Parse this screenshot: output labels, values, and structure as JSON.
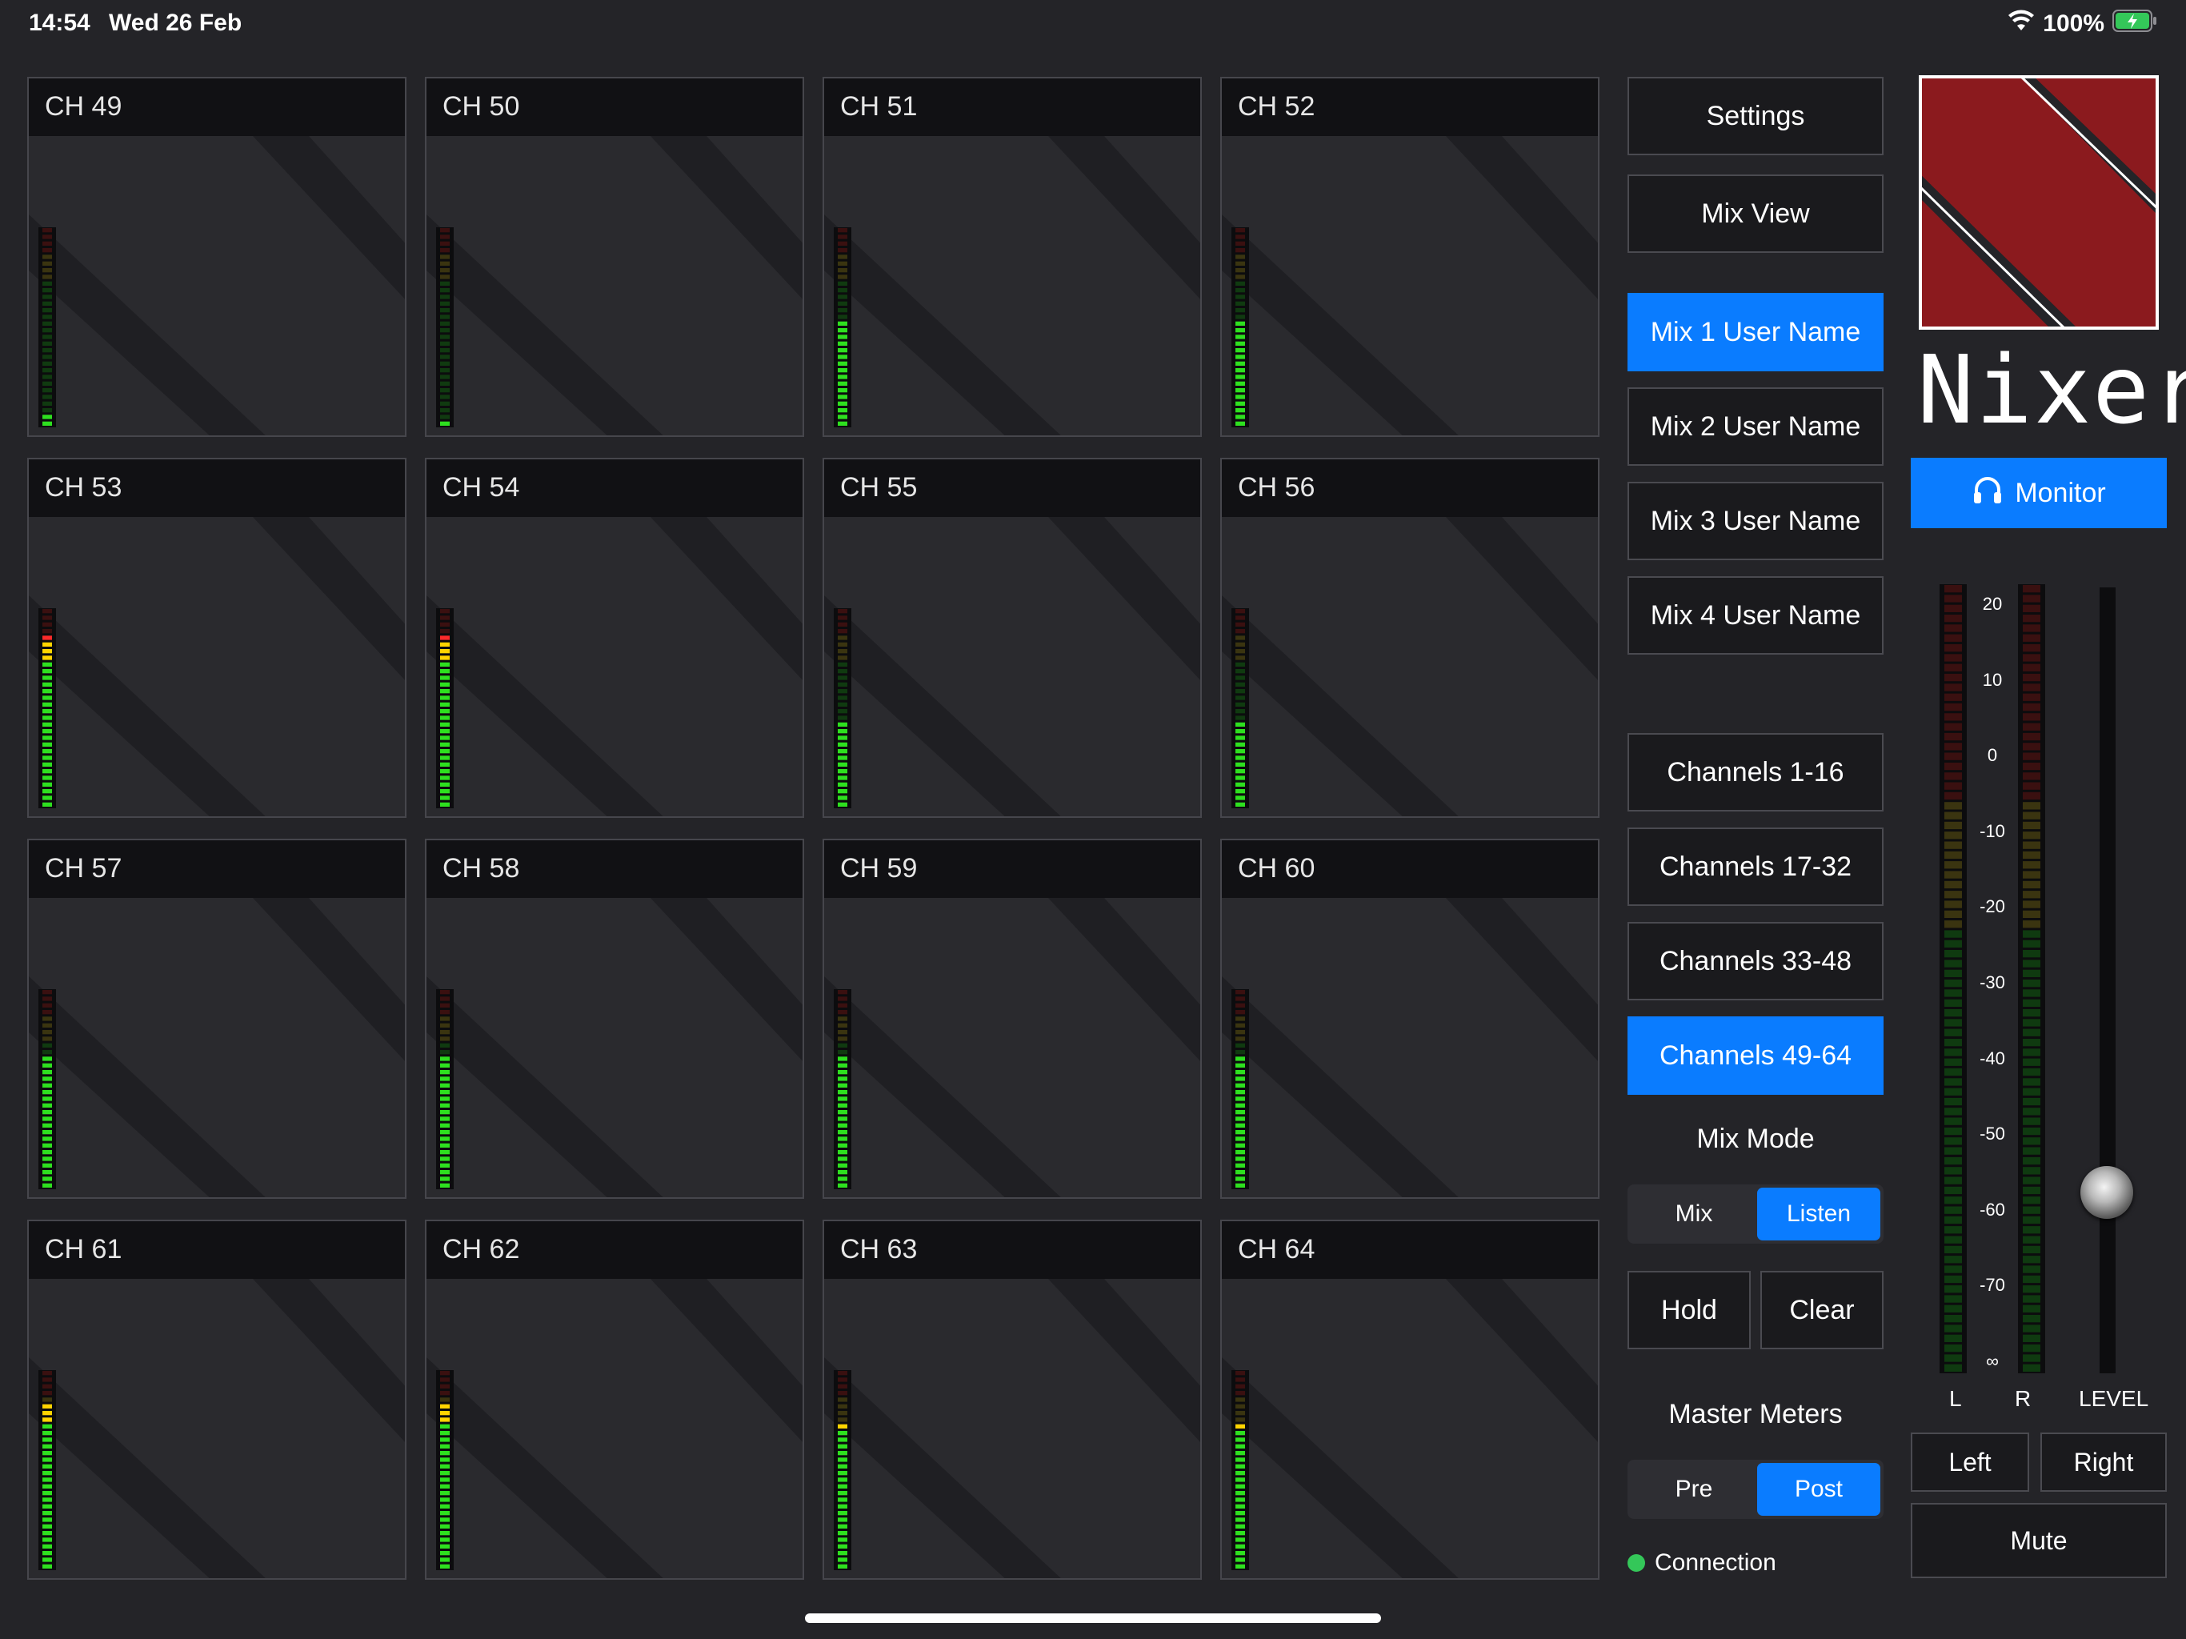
{
  "status_bar": {
    "time": "14:54",
    "date": "Wed 26 Feb",
    "battery": "100%",
    "wifi_icon": "wifi-icon",
    "battery_icon": "battery-charging-icon"
  },
  "channels": [
    {
      "name": "CH 49",
      "level": 0.07,
      "peak": null
    },
    {
      "name": "CH 50",
      "level": 0.03,
      "peak": null
    },
    {
      "name": "CH 51",
      "level": 0.53,
      "peak": null
    },
    {
      "name": "CH 52",
      "level": 0.53,
      "peak": null
    },
    {
      "name": "CH 53",
      "level": 0.87,
      "peak": "red"
    },
    {
      "name": "CH 54",
      "level": 0.87,
      "peak": "red"
    },
    {
      "name": "CH 55",
      "level": 0.43,
      "peak": null
    },
    {
      "name": "CH 56",
      "level": 0.43,
      "peak": null
    },
    {
      "name": "CH 57",
      "level": 0.67,
      "peak": null
    },
    {
      "name": "CH 58",
      "level": 0.67,
      "peak": null
    },
    {
      "name": "CH 59",
      "level": 0.67,
      "peak": null
    },
    {
      "name": "CH 60",
      "level": 0.67,
      "peak": null
    },
    {
      "name": "CH 61",
      "level": 0.83,
      "peak": null
    },
    {
      "name": "CH 62",
      "level": 0.83,
      "peak": null
    },
    {
      "name": "CH 63",
      "level": 0.73,
      "peak": "yellow"
    },
    {
      "name": "CH 64",
      "level": 0.73,
      "peak": "yellow"
    }
  ],
  "nav": {
    "settings": "Settings",
    "mix_view": "Mix View",
    "mixes": [
      {
        "label": "Mix 1 User Name",
        "active": true
      },
      {
        "label": "Mix 2 User Name",
        "active": false
      },
      {
        "label": "Mix 3 User Name",
        "active": false
      },
      {
        "label": "Mix 4 User Name",
        "active": false
      }
    ],
    "banks": [
      {
        "label": "Channels 1-16",
        "active": false
      },
      {
        "label": "Channels 17-32",
        "active": false
      },
      {
        "label": "Channels 33-48",
        "active": false
      },
      {
        "label": "Channels 49-64",
        "active": true
      }
    ]
  },
  "mix_mode": {
    "title": "Mix Mode",
    "options": [
      "Mix",
      "Listen"
    ],
    "selected": "Listen"
  },
  "hold_label": "Hold",
  "clear_label": "Clear",
  "master_meters": {
    "title": "Master Meters",
    "options": [
      "Pre",
      "Post"
    ],
    "selected": "Post"
  },
  "connection": {
    "label": "Connection",
    "status_color": "#34c759"
  },
  "brand": {
    "name": "Nixer",
    "logo_color": "#8b1a1e"
  },
  "monitor": {
    "label": "Monitor",
    "icon": "headphones-icon"
  },
  "master": {
    "scale": [
      "20",
      "10",
      "0",
      "-10",
      "-20",
      "-30",
      "-40",
      "-50",
      "-60",
      "-70",
      "∞"
    ],
    "left_label": "L",
    "right_label": "R",
    "level_label": "LEVEL",
    "fader_level": 0.23,
    "left_meter_level": 0.0,
    "right_meter_level": 0.0
  },
  "output": {
    "left": "Left",
    "right": "Right",
    "mute": "Mute"
  },
  "colors": {
    "accent": "#0a7cff",
    "background": "#242428",
    "meter_on": "#2ee01f",
    "meter_off": "#103a10"
  }
}
